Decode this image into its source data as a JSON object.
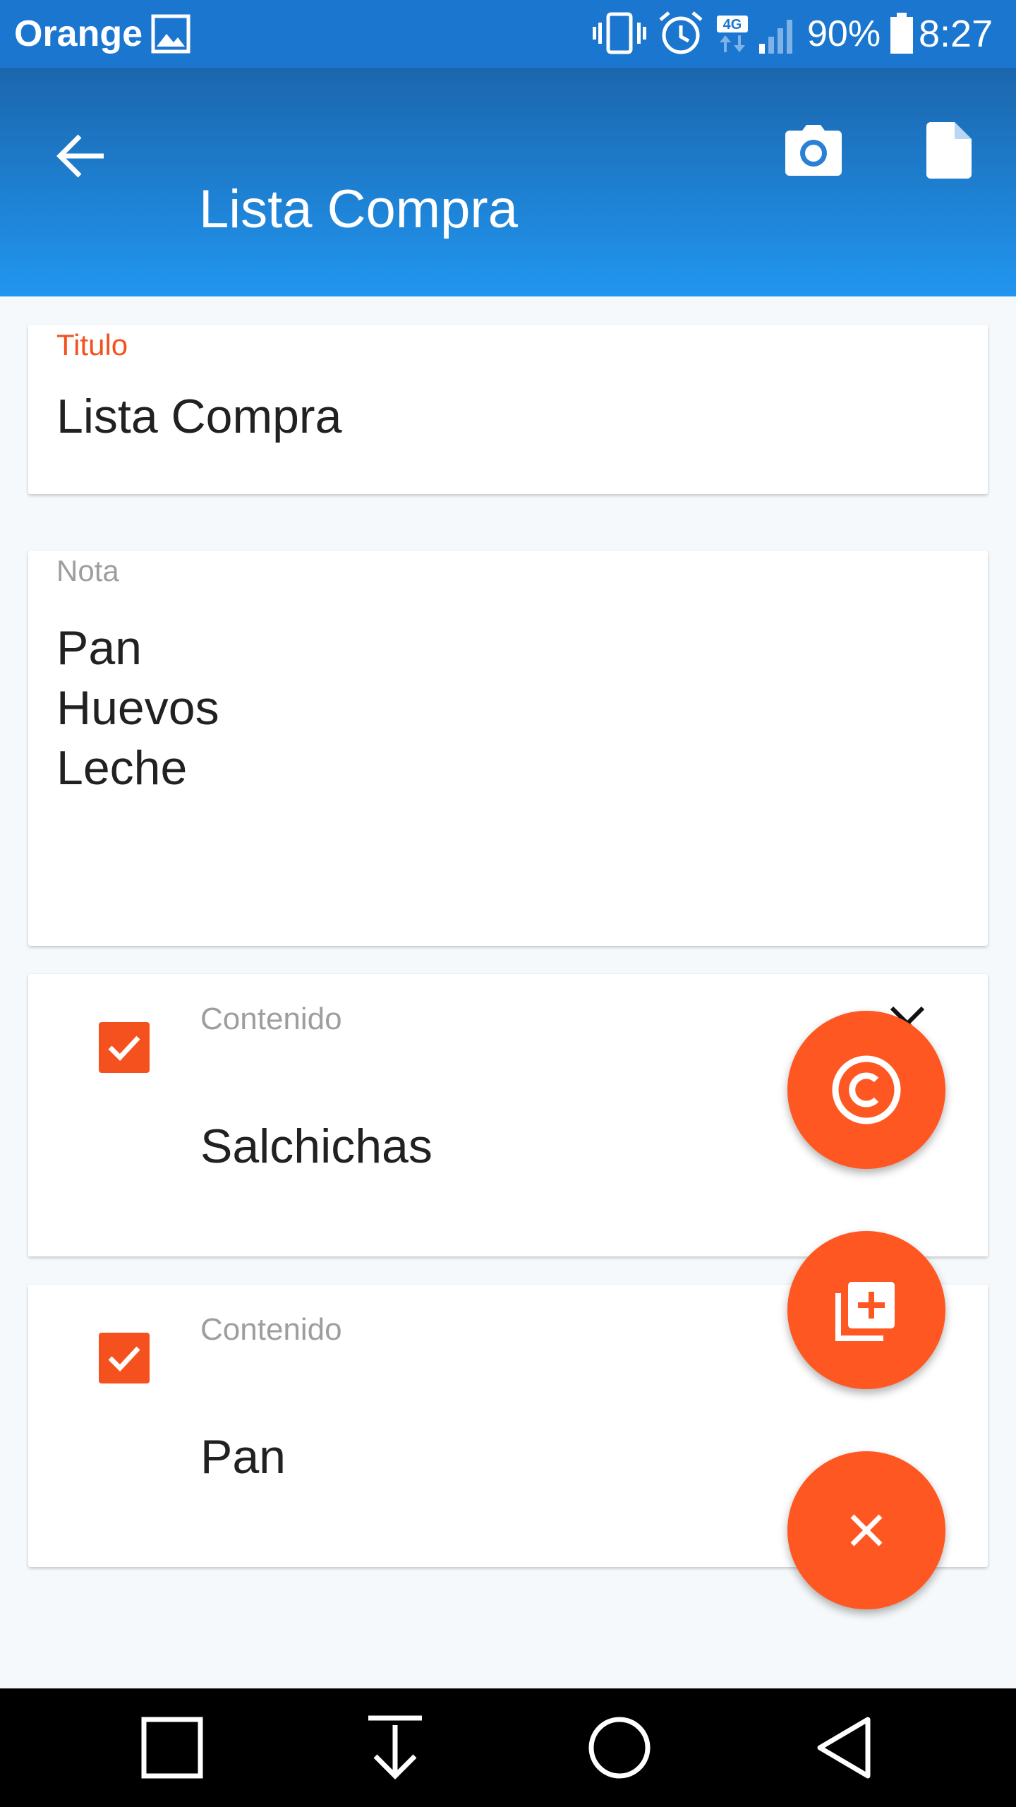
{
  "status_bar": {
    "carrier": "Orange",
    "battery": "90%",
    "time": "8:27",
    "network": "4G",
    "icons": [
      "gallery-icon",
      "vibrate-icon",
      "alarm-icon",
      "network-4g-icon",
      "signal-icon",
      "battery-icon"
    ]
  },
  "toolbar": {
    "title": "Lista Compra",
    "icons": [
      "arrow-back-icon",
      "camera-icon",
      "file-icon"
    ]
  },
  "titulo": {
    "label": "Titulo",
    "value": "Lista Compra"
  },
  "nota": {
    "label": "Nota",
    "lines": [
      "Pan",
      "Huevos",
      "Leche"
    ]
  },
  "items": [
    {
      "label": "Contenido",
      "value": "Salchichas",
      "checked": true
    },
    {
      "label": "Contenido",
      "value": "Pan",
      "checked": true
    }
  ],
  "fabs": [
    "copyright-icon",
    "add-copy-icon",
    "close-icon"
  ],
  "nav_bar": [
    "recent-apps-icon",
    "download-icon",
    "home-icon",
    "back-icon"
  ],
  "colors": {
    "status_bar": "#1a76cf",
    "toolbar_top": "#1b66ad",
    "toolbar_bottom": "#2196f0",
    "accent": "#ff5722",
    "label_active": "#f4511e",
    "label_inactive": "#9e9e9e",
    "background": "#f6f9fb"
  }
}
